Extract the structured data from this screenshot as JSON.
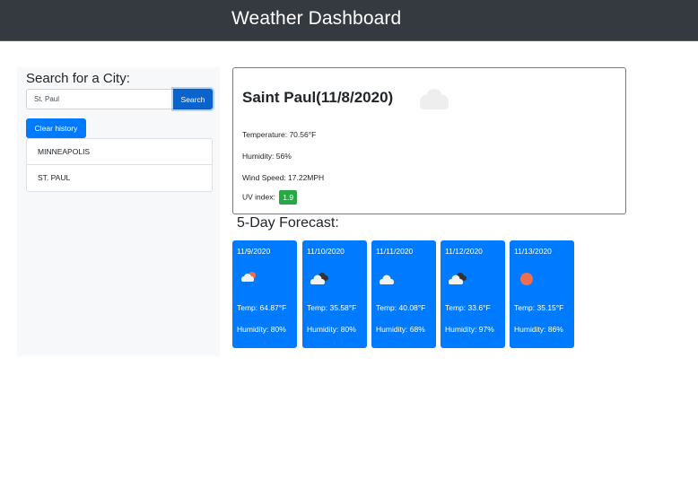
{
  "header": {
    "title": "Weather Dashboard"
  },
  "sidebar": {
    "title": "Search for a City:",
    "search": {
      "value": "St. Paul",
      "placeholder": ""
    },
    "search_button": "Search",
    "clear_button": "Clear history",
    "history": [
      {
        "label": "MINNEAPOLIS"
      },
      {
        "label": "ST. PAUL"
      }
    ]
  },
  "current": {
    "heading": "Saint Paul(11/8/2020)",
    "icon": "cloud-icon",
    "temperature": "Temperature: 70.56°F",
    "humidity": "Humidity: 56%",
    "wind": "Wind Speed: 17.22MPH",
    "uv_label": "UV index:",
    "uv_value": "1.9",
    "uv_color": "#28a745"
  },
  "forecast": {
    "title": "5-Day Forecast:",
    "card_color": "#007bff",
    "days": [
      {
        "date": "11/9/2020",
        "icon": "rain-sun-icon",
        "temp": "Temp: 64.87°F",
        "humidity": "Humidity: 80%"
      },
      {
        "date": "11/10/2020",
        "icon": "broken-clouds-icon",
        "temp": "Temp: 35.58°F",
        "humidity": "Humidity: 80%"
      },
      {
        "date": "11/11/2020",
        "icon": "cloud-icon",
        "temp": "Temp: 40.08°F",
        "humidity": "Humidity: 68%"
      },
      {
        "date": "11/12/2020",
        "icon": "broken-clouds-icon",
        "temp": "Temp: 33.6°F",
        "humidity": "Humidity: 97%"
      },
      {
        "date": "11/13/2020",
        "icon": "clear-sun-icon",
        "temp": "Temp: 35.15°F",
        "humidity": "Humidity: 86%"
      }
    ]
  }
}
